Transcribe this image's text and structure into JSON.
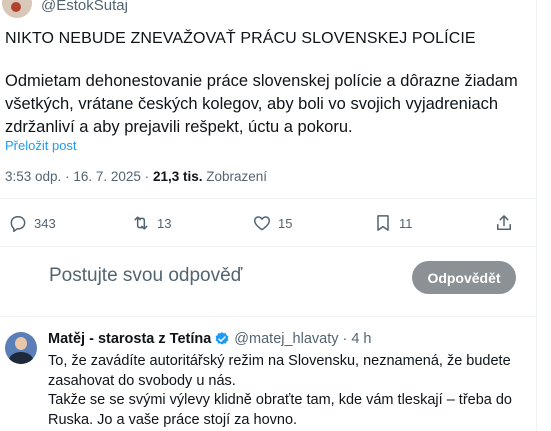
{
  "tweet": {
    "handle": "@EstokSutaj",
    "headline": "NIKTO NEBUDE ZNEVAŽOVAŤ PRÁCU SLOVENSKEJ POLÍCIE",
    "body": "Odmietam dehonestovanie práce slovenskej polície a dôrazne žiadam všetkých, vrátane českých kolegov, aby boli vo svojich vyjadreniach zdržanliví a aby prejavili rešpekt, úctu a pokoru.",
    "translate_label": "Přeložit post",
    "time": "3:53 odp.",
    "separator": "·",
    "date": "16. 7. 2025",
    "views_count": "21,3 tis.",
    "views_label": "Zobrazení"
  },
  "actions": {
    "replies": "343",
    "reposts": "13",
    "likes": "15",
    "bookmarks": "11"
  },
  "composer": {
    "placeholder": "Postujte svou odpověď",
    "button_label": "Odpovědět"
  },
  "reply": {
    "name": "Matěj - starosta z Tetína",
    "handle": "@matej_hlavaty",
    "separator": "·",
    "time": "4 h",
    "text_line1": "To, že zavádíte autoritářský režim na Slovensku, neznamená, že budete zasahovat do svobody u nás.",
    "text_line2": "Takže se se svými výlevy klidně obraťte tam, kde vám tleskají – třeba do Ruska. Jo a vaše práce stojí za hovno."
  },
  "colors": {
    "accent": "#1d9bf0",
    "muted": "#536471",
    "button_disabled": "#8c9196"
  }
}
